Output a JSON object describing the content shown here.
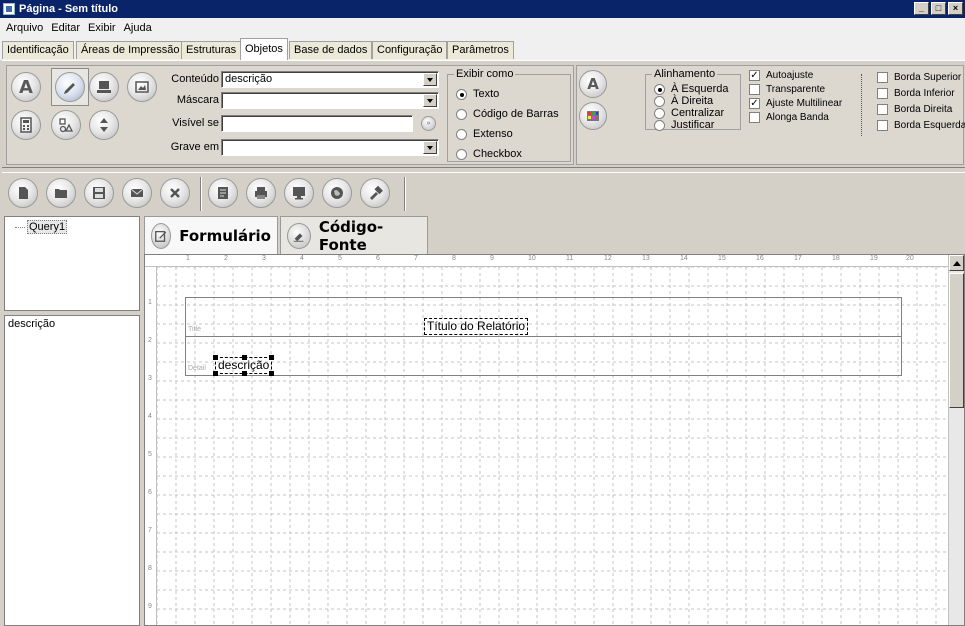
{
  "window": {
    "title": "Página - Sem título"
  },
  "menu": [
    "Arquivo",
    "Editar",
    "Exibir",
    "Ajuda"
  ],
  "tabs": [
    "Identificação",
    "Áreas de Impressão",
    "Estruturas",
    "Objetos",
    "Base de dados",
    "Configuração",
    "Parâmetros"
  ],
  "active_tab": "Objetos",
  "props": {
    "conteudo_label": "Conteúdo",
    "conteudo_value": "descrição",
    "mascara_label": "Máscara",
    "mascara_value": "",
    "visivel_label": "Visível se",
    "visivel_value": "",
    "grave_label": "Grave em",
    "grave_value": "",
    "exibir_como": {
      "legend": "Exibir como",
      "options": [
        "Texto",
        "Código de Barras",
        "Extenso",
        "Checkbox"
      ],
      "selected": "Texto"
    },
    "alinhamento": {
      "legend": "Alinhamento",
      "options": [
        "À Esquerda",
        "À Direita",
        "Centralizar",
        "Justificar"
      ],
      "selected": "À Esquerda"
    },
    "checks": [
      {
        "label": "Autoajuste",
        "checked": true
      },
      {
        "label": "Transparente",
        "checked": false
      },
      {
        "label": "Ajuste Multilinear",
        "checked": true
      },
      {
        "label": "Alonga Banda",
        "checked": false
      }
    ],
    "bordas": [
      "Borda Superior",
      "Borda Inferior",
      "Borda Direita",
      "Borda Esquerda"
    ]
  },
  "tree": {
    "root": "Query1"
  },
  "fields_list": [
    "descrição"
  ],
  "bottom_tabs": [
    "Formulário",
    "Código-Fonte"
  ],
  "ruler_top": [
    "1",
    "2",
    "3",
    "4",
    "5",
    "6",
    "7",
    "8",
    "9",
    "10",
    "11",
    "12",
    "13",
    "14",
    "15",
    "16",
    "17",
    "18",
    "19",
    "20"
  ],
  "ruler_left": [
    "1",
    "2",
    "3",
    "4",
    "5",
    "6",
    "7",
    "8",
    "9"
  ],
  "report": {
    "title_band_label": "Title",
    "detail_band_label": "Detail",
    "title_text": "Título do Relatório",
    "detail_text": "descrição"
  },
  "icons": {
    "toolbar": [
      "new-file-icon",
      "open-folder-icon",
      "save-icon",
      "mail-icon",
      "close-icon",
      "report-icon",
      "print-icon",
      "monitor-icon",
      "globe-icon",
      "hammer-icon"
    ]
  }
}
